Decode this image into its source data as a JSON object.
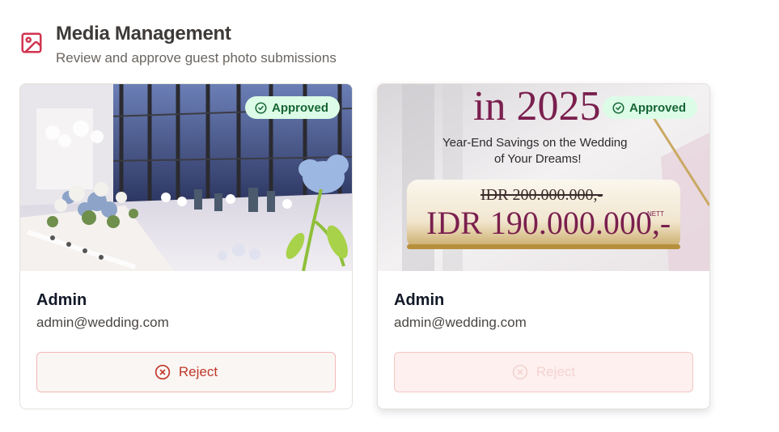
{
  "header": {
    "icon": "image-icon",
    "title": "Media Management",
    "subtitle": "Review and approve guest photo submissions"
  },
  "colors": {
    "accent": "#d1344f",
    "approved_bg": "#dcfce7",
    "approved_text": "#166534",
    "reject_text": "#c0392b"
  },
  "submissions": [
    {
      "status": "Approved",
      "uploader": "Admin",
      "email": "admin@wedding.com",
      "reject_label": "Reject",
      "image": "wedding reception hall photo"
    },
    {
      "status": "Approved",
      "uploader": "Admin",
      "email": "admin@wedding.com",
      "reject_label": "Reject",
      "image": "promotional banner",
      "promo": {
        "year_line": "in 2025",
        "tagline_1": "Year-End Savings on the Wedding",
        "tagline_2": "of Your Dreams!",
        "old_price": "IDR 200.000.000,-",
        "new_price": "IDR 190.000.000,-",
        "nett": "NETT"
      }
    }
  ]
}
